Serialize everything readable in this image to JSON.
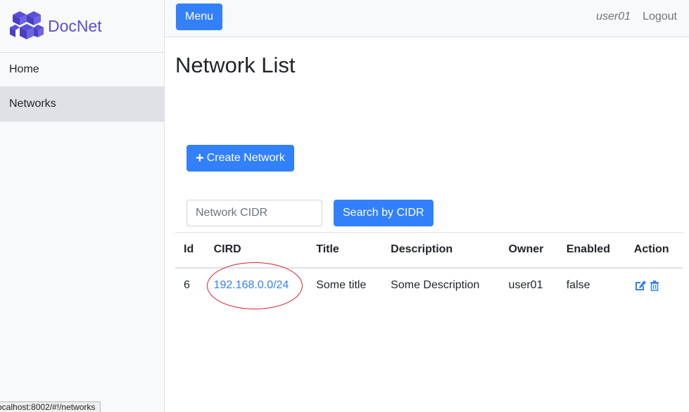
{
  "brand": {
    "name": "DocNet",
    "logo_icon": "cubes-logo-icon",
    "color": "#5a4fd6"
  },
  "sidebar": {
    "items": [
      {
        "label": "Home",
        "active": false
      },
      {
        "label": "Networks",
        "active": true
      }
    ]
  },
  "topbar": {
    "menu_label": "Menu",
    "user": "user01",
    "logout_label": "Logout"
  },
  "page": {
    "title": "Network List"
  },
  "actions": {
    "create_label": "Create Network",
    "create_icon": "plus-icon"
  },
  "search": {
    "placeholder": "Network CIDR",
    "value": "",
    "button_label": "Search by CIDR"
  },
  "table": {
    "headers": [
      "Id",
      "CIRD",
      "Title",
      "Description",
      "Owner",
      "Enabled",
      "Action"
    ],
    "rows": [
      {
        "id": "6",
        "cidr": "192.168.0.0/24",
        "title": "Some title",
        "description": "Some Description",
        "owner": "user01",
        "enabled": "false",
        "actions": [
          "edit-icon",
          "trash-icon"
        ]
      }
    ]
  },
  "status_bar": {
    "url": "ocalhost:8002/#!/networks"
  },
  "colors": {
    "primary": "#3280fc",
    "annotation": "#d3242f"
  }
}
